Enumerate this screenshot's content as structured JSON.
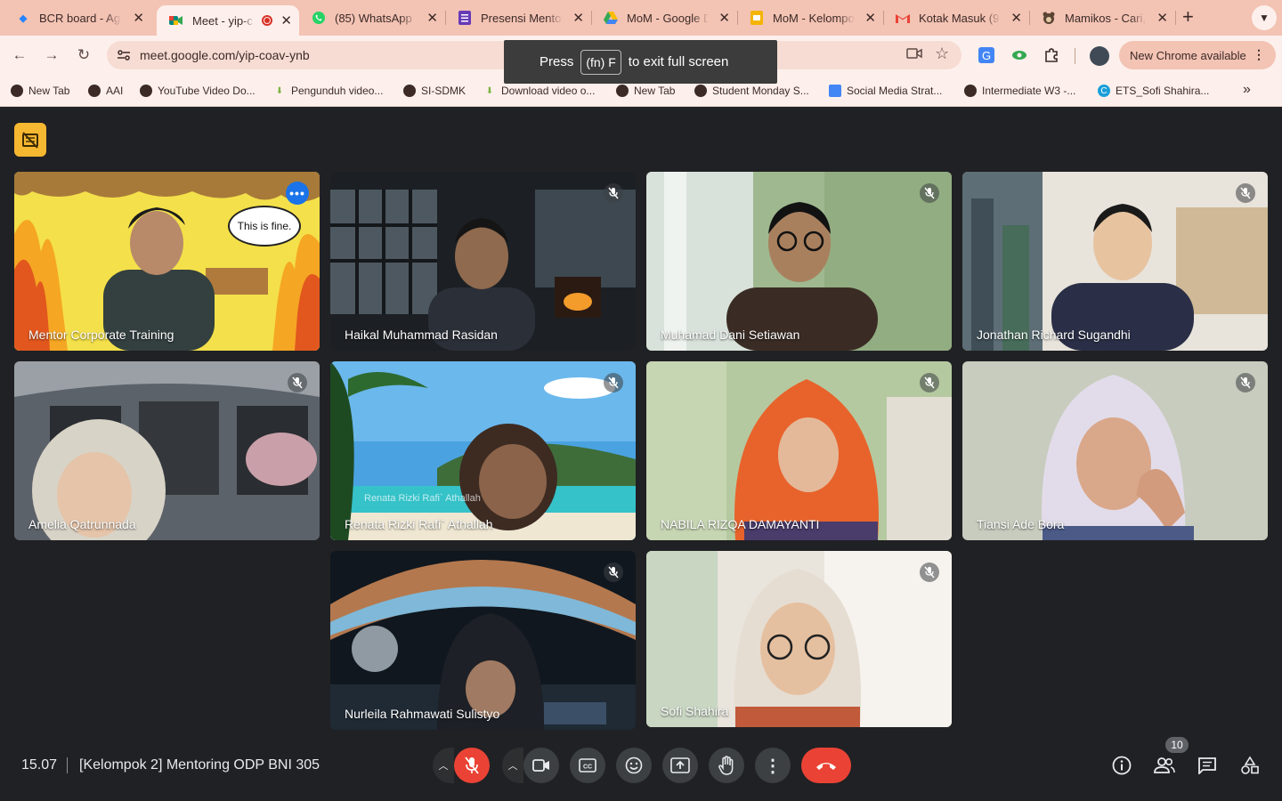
{
  "browser": {
    "tabs": [
      {
        "title": "BCR board - Agi",
        "icon": "jira-icon",
        "color": "#2684ff"
      },
      {
        "title": "Meet - yip-c",
        "icon": "google-meet-icon",
        "color": "#00897b",
        "active": true,
        "recording": true
      },
      {
        "title": "(85) WhatsApp",
        "icon": "whatsapp-icon",
        "color": "#25d366"
      },
      {
        "title": "Presensi Mentor",
        "icon": "google-forms-icon",
        "color": "#673ab7"
      },
      {
        "title": "MoM - Google D",
        "icon": "google-drive-icon",
        "color": "#fbbc04"
      },
      {
        "title": "MoM - Kelompo",
        "icon": "google-slides-icon",
        "color": "#f4b400"
      },
      {
        "title": "Kotak Masuk (9",
        "icon": "gmail-icon",
        "color": "#ea4335"
      },
      {
        "title": "Mamikos - Cari,",
        "icon": "mamikos-icon",
        "color": "#1baa56"
      }
    ],
    "url": "meet.google.com/yip-coav-ynb",
    "update_label": "New Chrome available",
    "bookmarks": [
      {
        "label": "New Tab",
        "icon": "globe-icon"
      },
      {
        "label": "AAI",
        "icon": "globe-icon"
      },
      {
        "label": "YouTube Video Do...",
        "icon": "globe-icon"
      },
      {
        "label": "Pengunduh video...",
        "icon": "download-icon"
      },
      {
        "label": "SI-SDMK",
        "icon": "globe-icon"
      },
      {
        "label": "Download video o...",
        "icon": "download-icon"
      },
      {
        "label": "New Tab",
        "icon": "globe-icon"
      },
      {
        "label": "Student Monday S...",
        "icon": "globe-icon"
      },
      {
        "label": "Social Media Strat...",
        "icon": "docs-icon"
      },
      {
        "label": "Intermediate W3 -...",
        "icon": "globe-icon"
      },
      {
        "label": "ETS_Sofi Shahira...",
        "icon": "canva-icon"
      }
    ]
  },
  "fullscreen_toast": {
    "press": "Press",
    "key": "(fn) F",
    "message": "to exit full screen"
  },
  "meeting": {
    "time": "15.07",
    "title": "[Kelompok 2] Mentoring ODP BNI 305",
    "participant_count": "10",
    "participants": [
      {
        "name": "Mentor Corporate Training",
        "muted": false,
        "speaking": true,
        "speech_bubble": "This is fine."
      },
      {
        "name": "Haikal Muhammad Rasidan",
        "muted": true
      },
      {
        "name": "Muhamad Dani Setiawan",
        "muted": true
      },
      {
        "name": "Jonathan Richard Sugandhi",
        "muted": true
      },
      {
        "name": "Amelia Qatrunnada",
        "muted": true
      },
      {
        "name": "Renata Rizki Rafi` Athallah",
        "muted": true,
        "background_caption": "Renata Rizki Rafi` Athallah"
      },
      {
        "name": "NABILA RIZQA DAMAYANTI",
        "muted": true
      },
      {
        "name": "Tiansi Ade Bora",
        "muted": true
      },
      {
        "name": "Nurleila Rahmawati Sulistyo",
        "muted": true
      },
      {
        "name": "Sofi Shahira",
        "muted": true
      }
    ]
  },
  "colors": {
    "chrome_tabstrip": "#f3c3b4",
    "chrome_toolbar": "#fdf0ec",
    "meet_background": "#202124",
    "leave_red": "#ea4335",
    "active_speaker_outline": "#8ab4f8"
  }
}
